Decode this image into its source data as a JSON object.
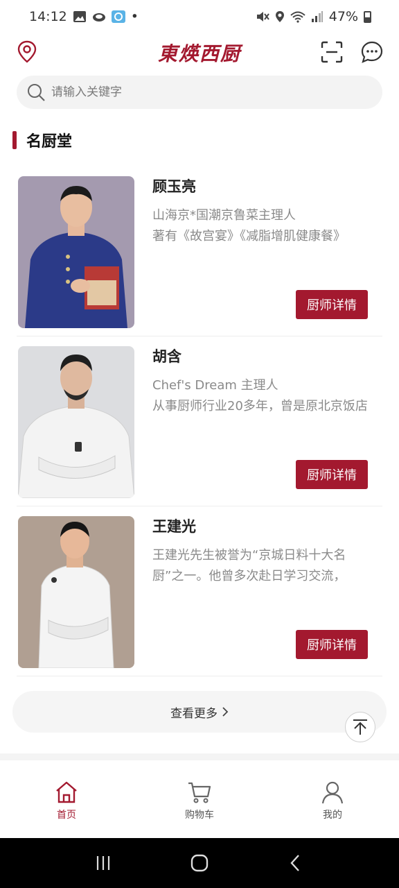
{
  "status_bar": {
    "time": "14:12",
    "dot": "•",
    "battery_percent": "47%",
    "icons_left": [
      "gallery-icon",
      "cloud-icon",
      "app-icon"
    ],
    "icons_right": [
      "mute-icon",
      "location-icon",
      "wifi-icon",
      "signal-icon",
      "battery-icon"
    ]
  },
  "header": {
    "logo_text": "東煐西厨",
    "left_icon": "location-pin-icon",
    "right_icons": [
      "scan-icon",
      "message-icon"
    ]
  },
  "search": {
    "placeholder": "请输入关键字"
  },
  "section": {
    "title": "名厨堂"
  },
  "chefs": [
    {
      "name": "顾玉亮",
      "title": "山海京*国潮京鲁菜主理人",
      "desc": "著有《故宫宴》《减脂增肌健康餐》",
      "button": "厨师详情"
    },
    {
      "name": "胡含",
      "title": "Chef's Dream 主理人",
      "desc": "从事厨师行业20多年，曾是原北京饭店",
      "button": "厨师详情"
    },
    {
      "name": "王建光",
      "title": "",
      "desc": "王建光先生被誉为“京城日料十大名厨”之一。他曾多次赴日学习交流，",
      "button": "厨师详情"
    }
  ],
  "view_more": {
    "label": "查看更多"
  },
  "bottom_nav": [
    {
      "label": "首页",
      "icon": "home-icon",
      "active": true
    },
    {
      "label": "购物车",
      "icon": "cart-icon",
      "active": false
    },
    {
      "label": "我的",
      "icon": "user-icon",
      "active": false
    }
  ],
  "colors": {
    "brand": "#a3192f",
    "search_bg": "#f3f3f3",
    "muted_text": "#8a8a8a"
  }
}
